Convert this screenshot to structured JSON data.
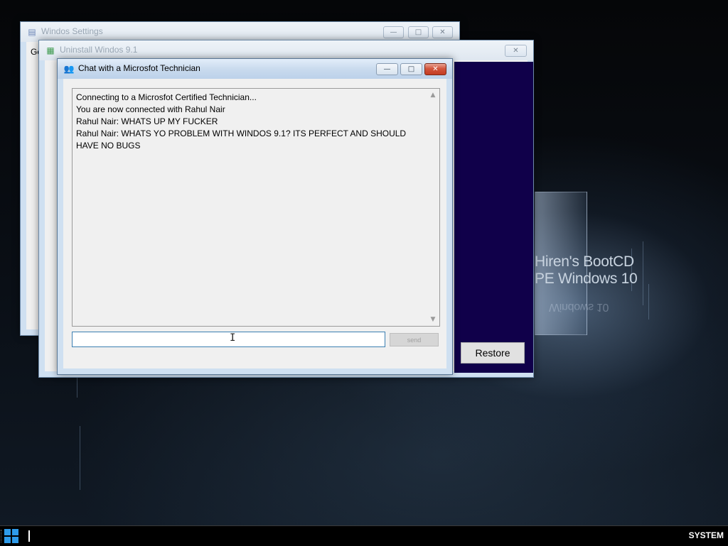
{
  "desktop": {
    "brand_line1": "Hiren's BootCD",
    "brand_line2": "PE Windows 10",
    "brand_reflection": "Windows 10"
  },
  "settings_window": {
    "title": "Windos Settings",
    "client_fragment": "Ge",
    "minimize_glyph": "—",
    "maximize_glyph": "□",
    "close_glyph": "✕"
  },
  "uninstall_window": {
    "title": "Uninstall Windos 9.1",
    "close_glyph": "✕",
    "restore_label": "Restore"
  },
  "chat_window": {
    "title": "Chat with a Microsfot Technician",
    "minimize_glyph": "—",
    "maximize_glyph": "□",
    "close_glyph": "✕",
    "messages": [
      "Connecting to a Microsfot Certified Technician...",
      "You are now connected with Rahul Nair",
      "Rahul Nair: WHATS UP MY FUCKER",
      "Rahul Nair: WHATS YO PROBLEM WITH WINDOS 9.1? ITS PERFECT AND SHOULD",
      "HAVE NO BUGS"
    ],
    "input_value": "",
    "send_label": "send",
    "scroll_up_glyph": "▲",
    "scroll_down_glyph": "▼"
  },
  "taskbar": {
    "user_label": "SYSTEM"
  },
  "icons": {
    "settings_window_icon": "▤",
    "uninstall_window_icon": "▦",
    "chat_window_icon": "👥",
    "text_cursor": "I"
  },
  "colors": {
    "purple_panel": "#10004a",
    "start_blue": "#2e9bea",
    "close_red": "#c23b22"
  }
}
